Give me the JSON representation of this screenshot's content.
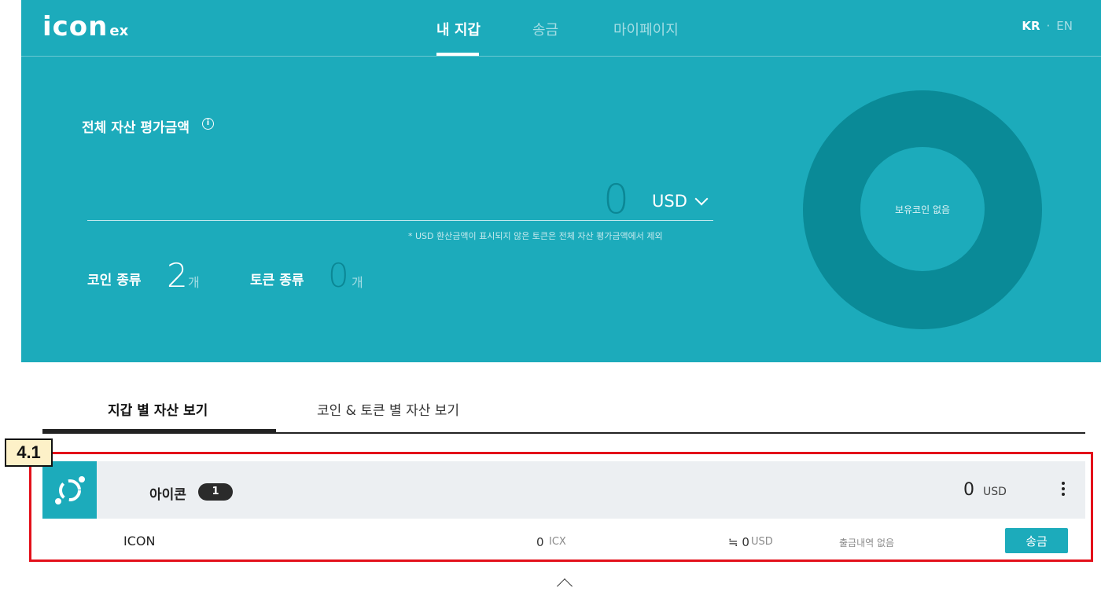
{
  "header": {
    "logo_main": "icon",
    "logo_sub": "ex",
    "nav": [
      {
        "label": "내 지갑",
        "active": true
      },
      {
        "label": "송금",
        "active": false
      },
      {
        "label": "마이페이지",
        "active": false
      }
    ],
    "lang_kr": "KR",
    "lang_sep": "·",
    "lang_en": "EN"
  },
  "summary": {
    "total_label": "전체 자산 평가금액",
    "info_glyph": "i",
    "amount": "0",
    "currency": "USD",
    "note": "* USD 환산금액이 표시되지 않은 토큰은 전체 자산 평가금액에서 제외",
    "coin_kind_label": "코인 종류",
    "coin_kind_count": "2",
    "coin_kind_unit": "개",
    "token_kind_label": "토큰 종류",
    "token_kind_count": "0",
    "token_kind_unit": "개",
    "donut_label": "보유코인 없음"
  },
  "tabs": [
    {
      "label": "지갑 별 자산 보기",
      "active": true
    },
    {
      "label": "코인 & 토큰 별 자산 보기",
      "active": false
    }
  ],
  "annotation": {
    "tag": "4.1"
  },
  "wallet": {
    "name": "아이콘",
    "count": "1",
    "total": "0",
    "total_unit": "USD",
    "coin": {
      "name": "ICON",
      "balance": "0",
      "balance_unit": "ICX",
      "usd_value": "≒ 0",
      "usd_unit": "USD",
      "history": "출금내역 없음",
      "send_label": "송금"
    }
  },
  "colors": {
    "accent": "#1cabbb",
    "accent_dark": "#0a8a97",
    "annotation_red": "#e3101a",
    "annotation_tag_bg": "#fdf1c8"
  },
  "icons": [
    "icon-logo",
    "info-icon",
    "chevron-down-icon",
    "icx-coin-icon",
    "kebab-menu-icon",
    "chevron-up-icon"
  ]
}
